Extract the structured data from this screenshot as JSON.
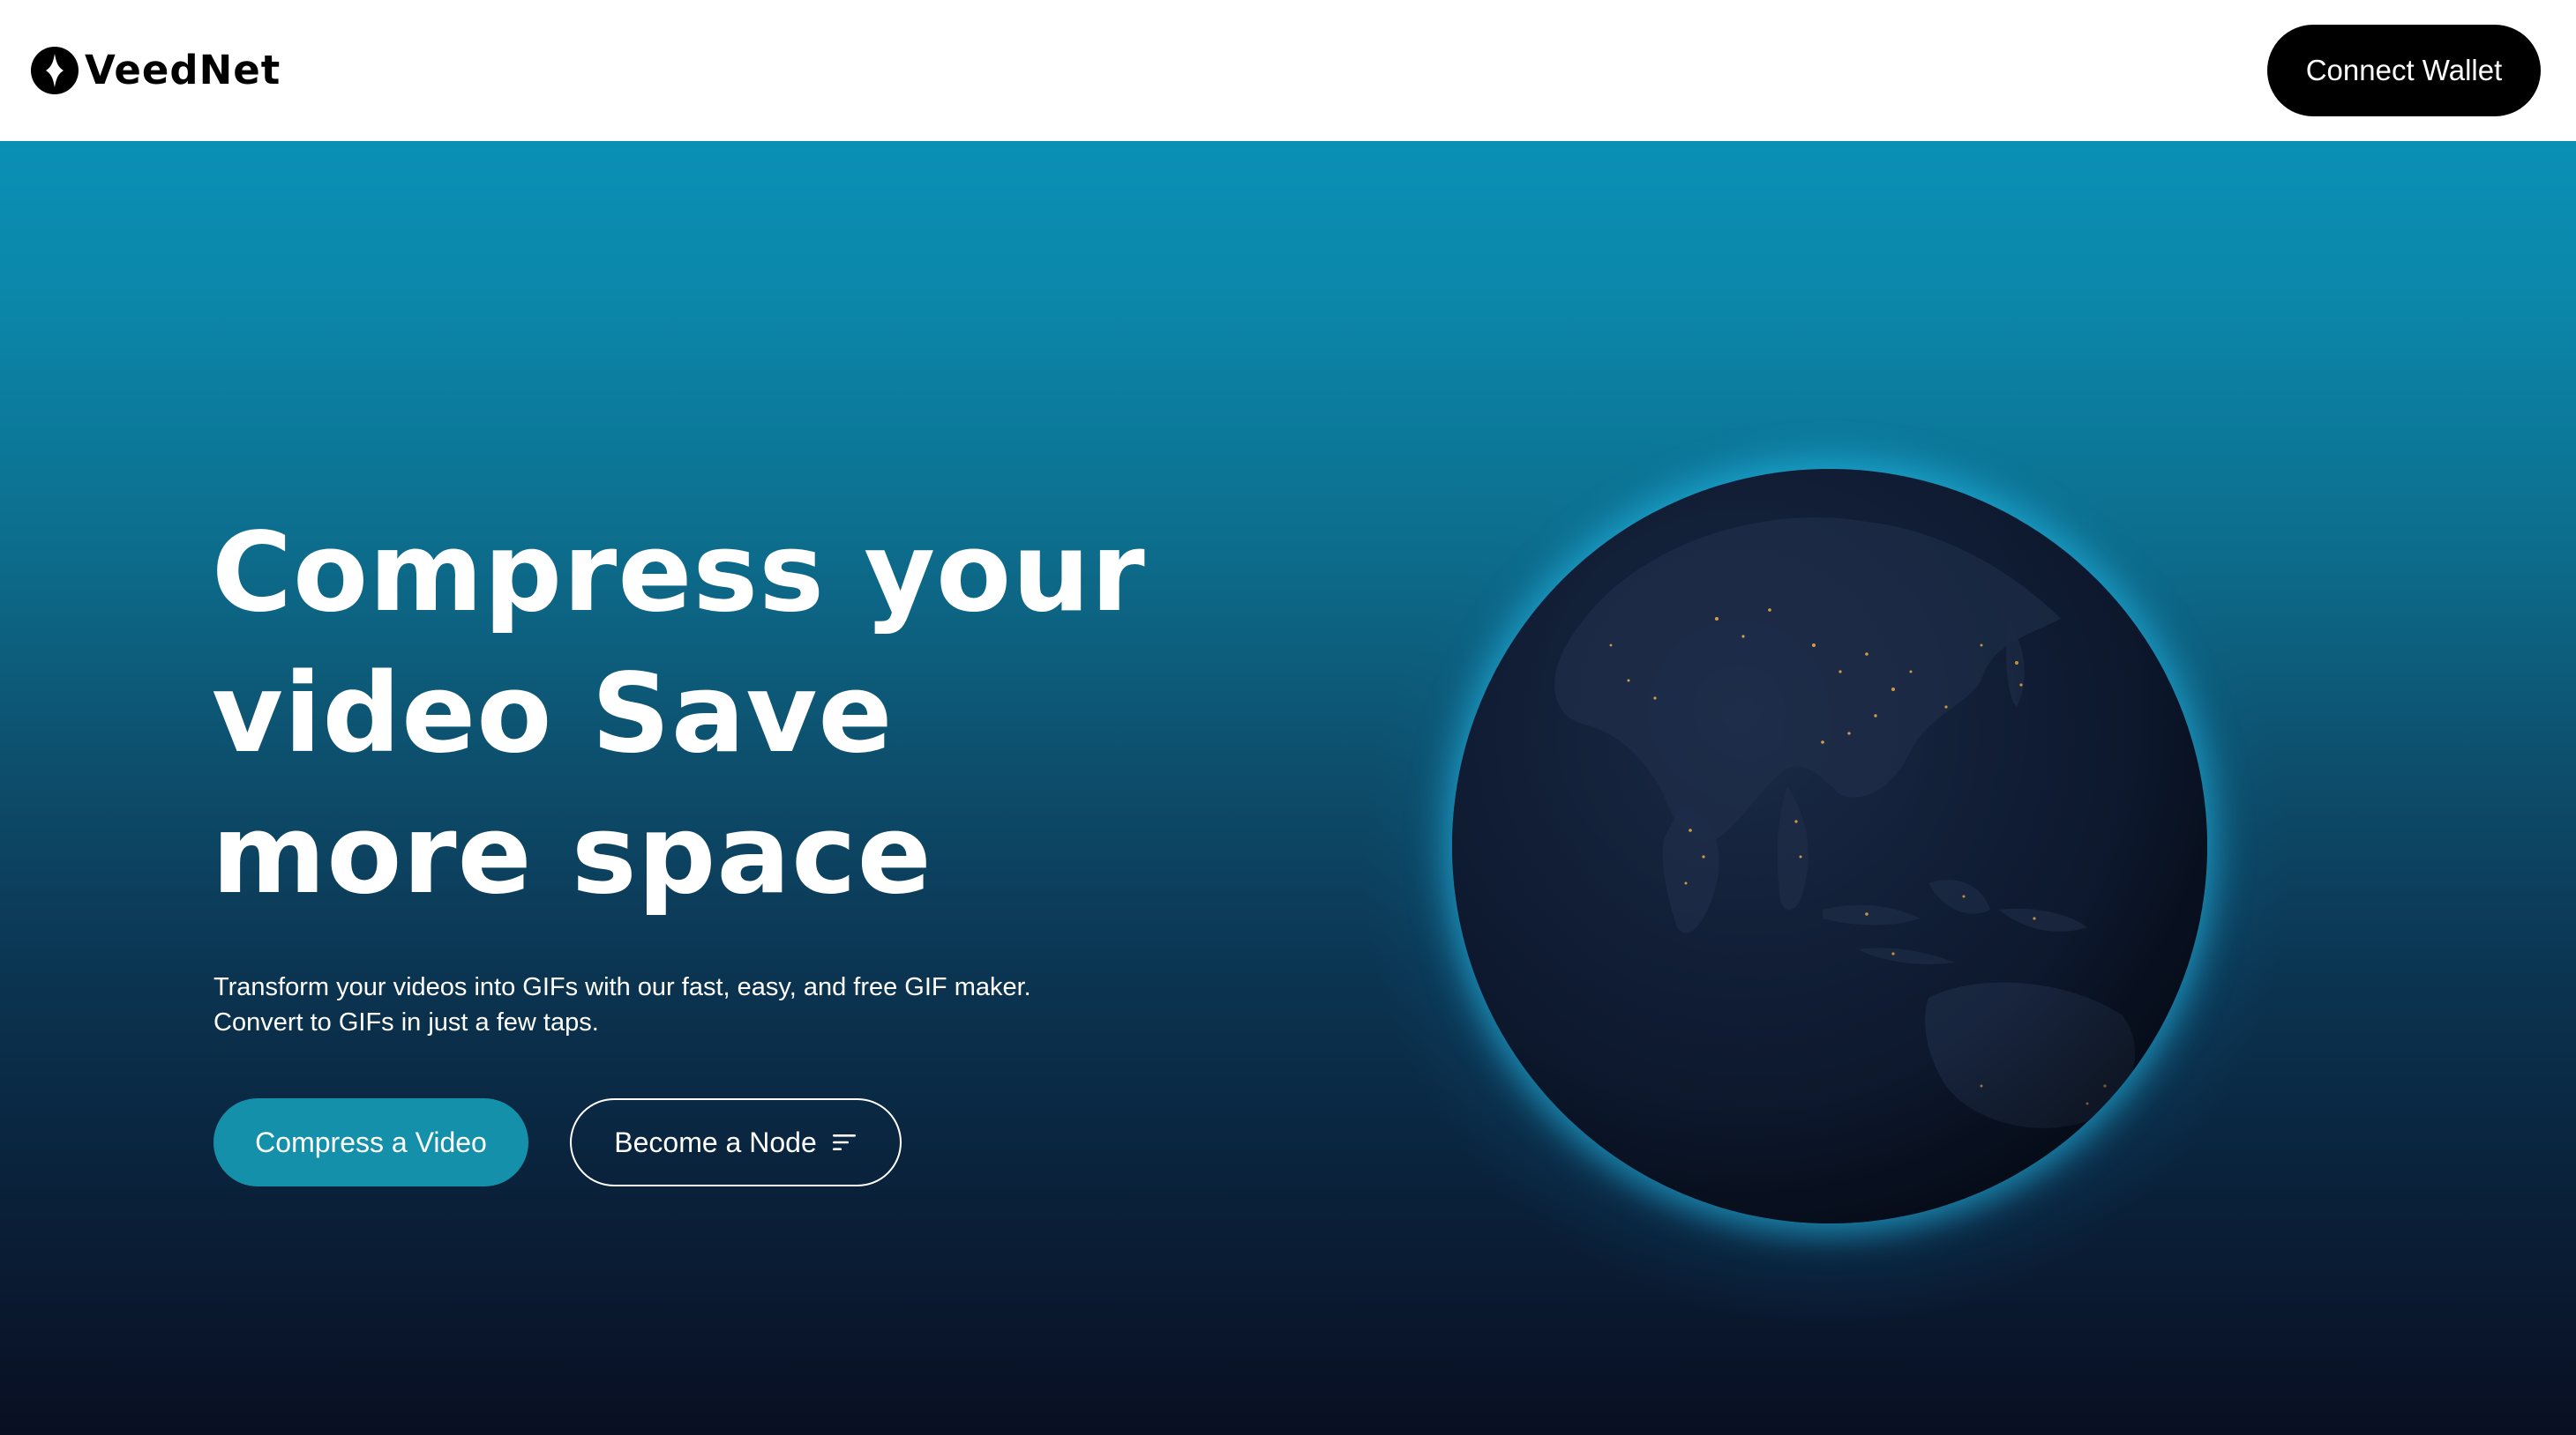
{
  "header": {
    "logo_text": "VeedNet",
    "connect_wallet_label": "Connect Wallet"
  },
  "hero": {
    "headline": [
      "Compress your",
      "video Save",
      "more space"
    ],
    "subtext": [
      "Transform your videos into GIFs with our fast, easy, and free GIF maker.",
      "Convert to GIFs in just a few taps."
    ],
    "primary_button_label": "Compress a Video",
    "secondary_button_label": "Become a Node",
    "secondary_button_icon": "menu-lines-icon",
    "globe": "earth-globe-at-night"
  },
  "colors": {
    "header_bg": "#ffffff",
    "connect_button_bg": "#000000",
    "primary_button_bg": "#1590ab",
    "hero_gradient_top": "#0a90b5",
    "hero_gradient_bottom": "#090f22",
    "globe_glow": "#28d2ff"
  }
}
